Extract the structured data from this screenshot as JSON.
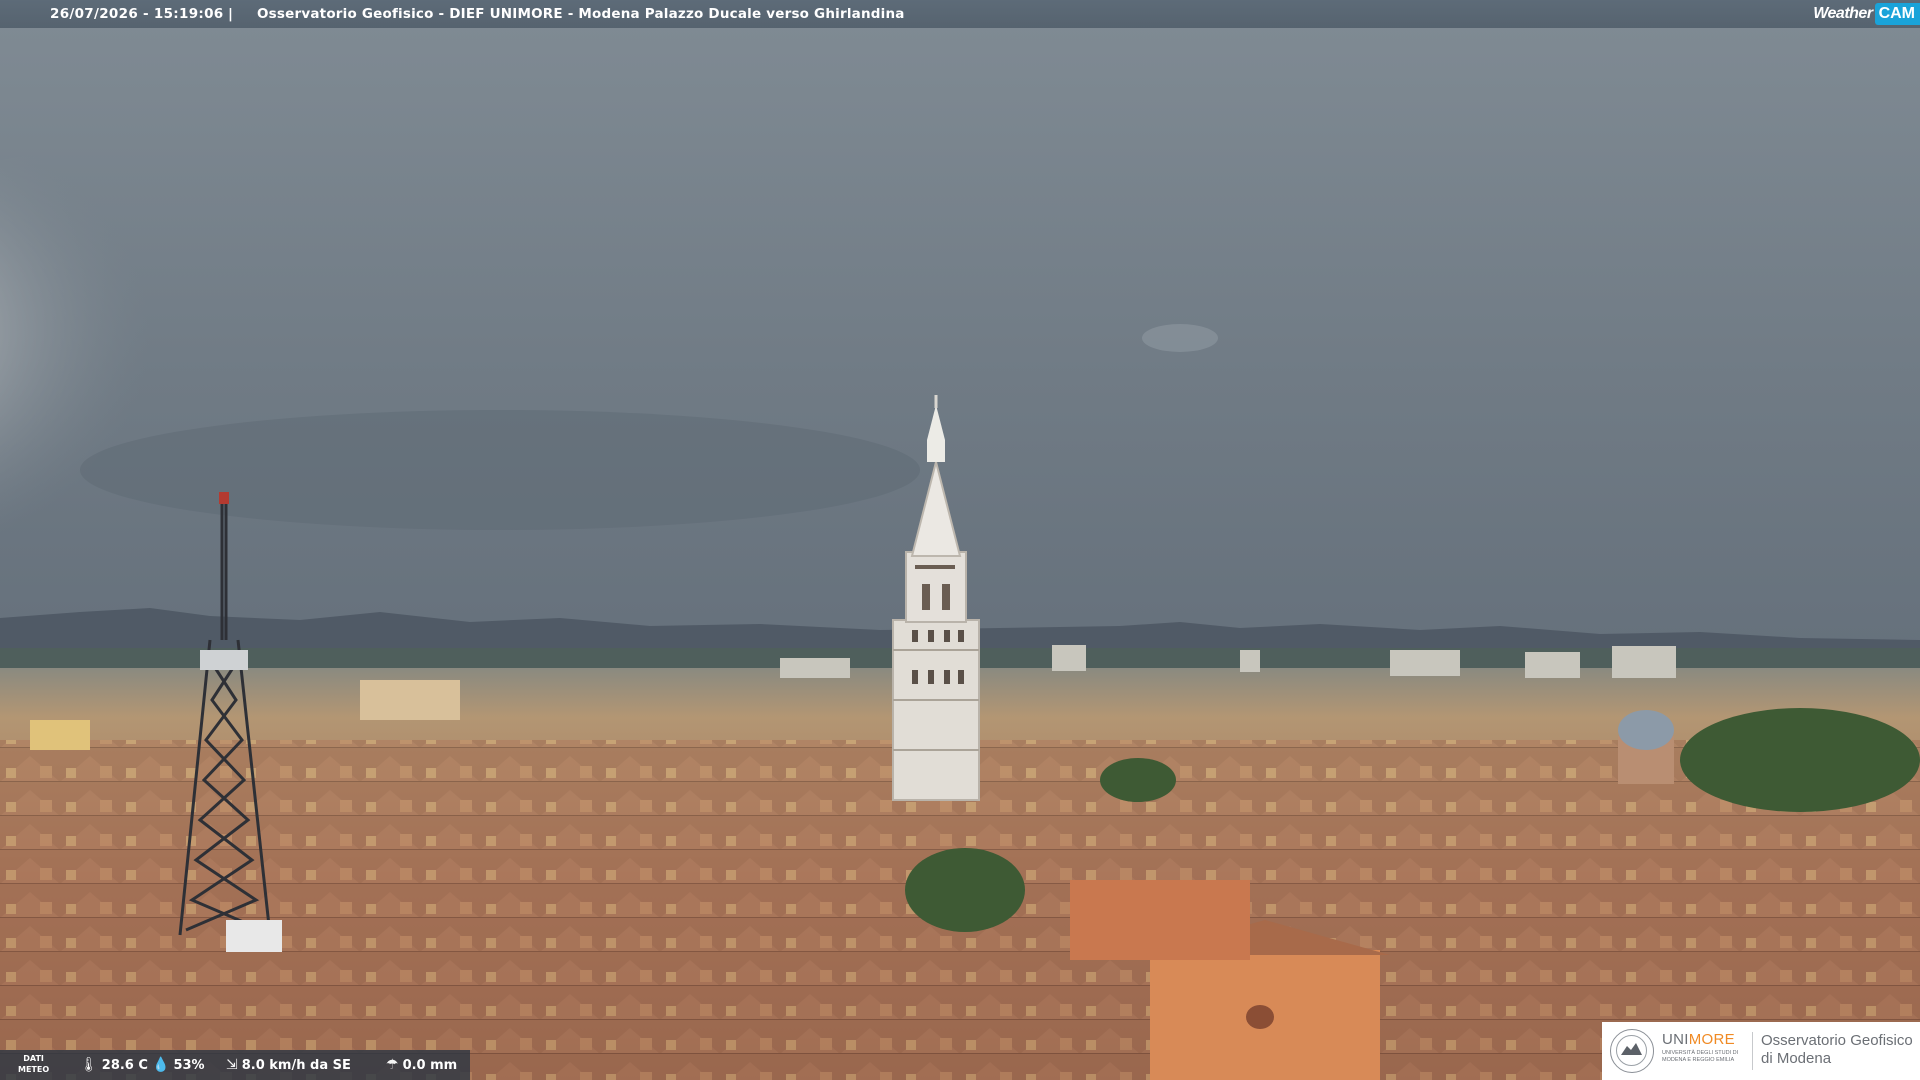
{
  "banner": {
    "timestamp": "26/07/2026 - 15:19:06",
    "separator": "|",
    "title": "Osservatorio Geofisico - DIEF UNIMORE - Modena Palazzo Ducale verso Ghirlandina"
  },
  "weathercam_logo": {
    "word": "Weather",
    "cam": "CAM"
  },
  "meteo": {
    "label_line1": "DATI",
    "label_line2": "METEO",
    "temperature": "28.6 C",
    "humidity": "53%",
    "wind": "8.0 km/h da SE",
    "rain": "0.0 mm",
    "icons": [
      "thermometer-icon",
      "humidity-drop-icon",
      "wind-icon",
      "rain-icon"
    ]
  },
  "unimore_logo": {
    "brand_uni": "UNI",
    "brand_more": "MORE",
    "subtitle": "UNIVERSITÀ DEGLI STUDI DI MODENA E REGGIO EMILIA",
    "observatory_line1": "Osservatorio Geofisico",
    "observatory_line2": "di Modena"
  },
  "colors": {
    "sky": "#6f7a84",
    "mountains": "#4f5965",
    "roofs": "#9c6a4e",
    "tower": "#e4e0da",
    "brand_orange": "#f08a24",
    "cam_blue": "#1aa3d9"
  }
}
